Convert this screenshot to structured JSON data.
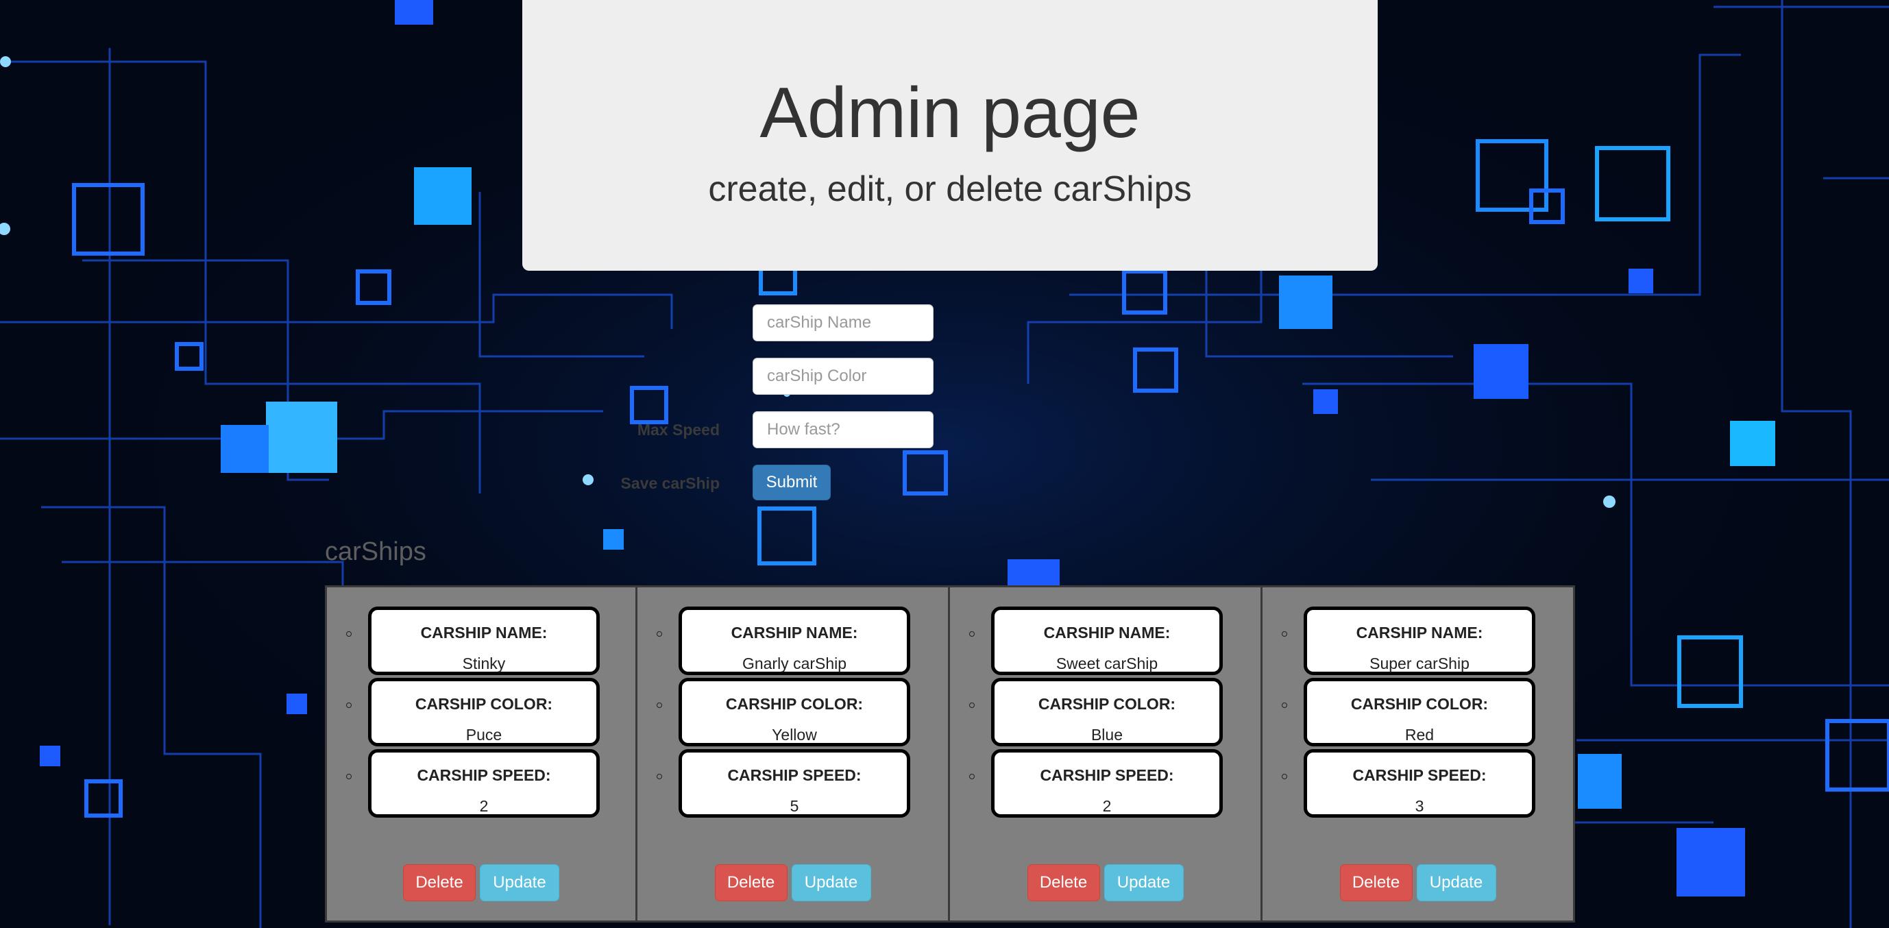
{
  "header": {
    "title": "Admin page",
    "subtitle": "create, edit, or delete carShips"
  },
  "form": {
    "name_placeholder": "carShip Name",
    "color_placeholder": "carShip Color",
    "speed_label": "Max Speed",
    "speed_placeholder": "How fast?",
    "save_label": "Save carShip",
    "submit_label": "Submit"
  },
  "list": {
    "title": "carShips",
    "name_label": "CARSHIP NAME:",
    "color_label": "CARSHIP COLOR:",
    "speed_label": "CARSHIP SPEED:",
    "delete_label": "Delete",
    "update_label": "Update",
    "items": [
      {
        "name": "Stinky",
        "color": "Puce",
        "speed": "2"
      },
      {
        "name": "Gnarly carShip",
        "color": "Yellow",
        "speed": "5"
      },
      {
        "name": "Sweet carShip",
        "color": "Blue",
        "speed": "2"
      },
      {
        "name": "Super carShip",
        "color": "Red",
        "speed": "3"
      }
    ]
  },
  "colors": {
    "background": "#020816",
    "circuit": "#1e5bff",
    "jumbotron": "#eeeeee",
    "card": "#808080",
    "primary": "#337ab7",
    "danger": "#d9534f",
    "info": "#5bc0de"
  }
}
